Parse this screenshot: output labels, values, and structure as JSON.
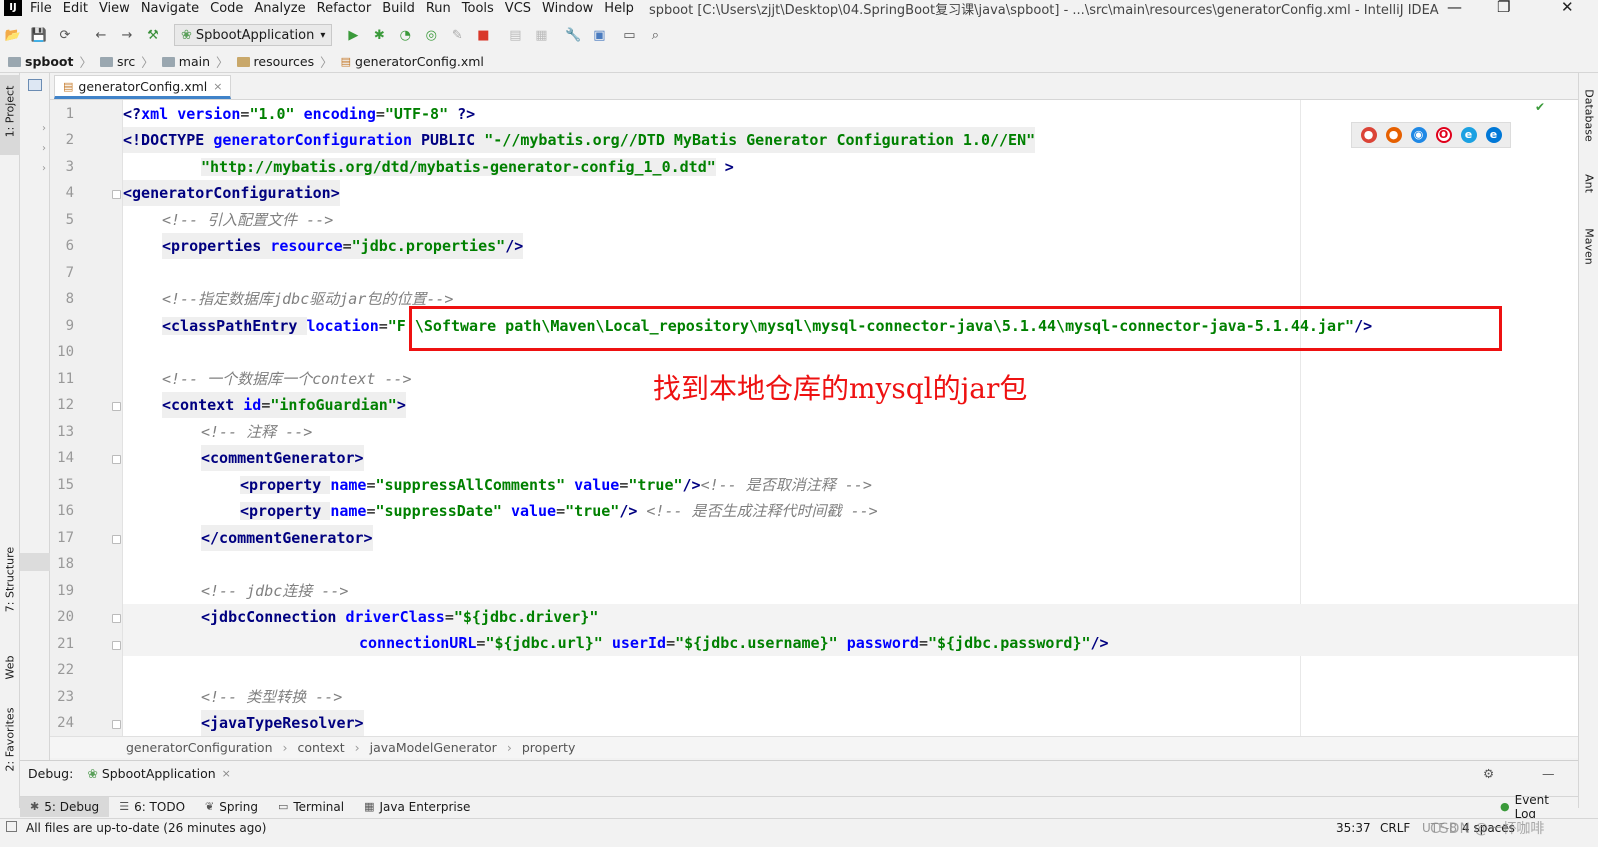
{
  "app": {
    "logo": "IJ",
    "title": "spboot [C:\\Users\\zjjt\\Desktop\\04.SpringBoot复习课\\java\\spboot] - ...\\src\\main\\resources\\generatorConfig.xml - IntelliJ IDEA",
    "window_controls": {
      "minimize": "—",
      "restore": "❐",
      "close": "✕"
    }
  },
  "menu": [
    "File",
    "Edit",
    "View",
    "Navigate",
    "Code",
    "Analyze",
    "Refactor",
    "Build",
    "Run",
    "Tools",
    "VCS",
    "Window",
    "Help"
  ],
  "toolbar": {
    "run_config": "SpbootApplication"
  },
  "navbar": {
    "crumbs": [
      "spboot",
      "src",
      "main",
      "resources",
      "generatorConfig.xml"
    ]
  },
  "left_tools": [
    "1: Project",
    "7: Structure",
    "Web",
    "2: Favorites"
  ],
  "right_tools": [
    "Database",
    "Ant",
    "Maven"
  ],
  "editor_tab": {
    "label": "generatorConfig.xml",
    "close": "×"
  },
  "line_numbers": [
    "1",
    "2",
    "3",
    "4",
    "5",
    "6",
    "7",
    "8",
    "9",
    "10",
    "11",
    "12",
    "13",
    "14",
    "15",
    "16",
    "17",
    "18",
    "19",
    "20",
    "21",
    "22",
    "23",
    "24"
  ],
  "code": {
    "l1": [
      "<?",
      "xml ",
      "version",
      "=",
      "\"1.0\"",
      " ",
      "encoding",
      "=",
      "\"UTF-8\"",
      " ",
      "?>"
    ],
    "l2": [
      "<!DOCTYPE ",
      "generatorConfiguration ",
      "PUBLIC ",
      "\"-//mybatis.org//DTD MyBatis Generator Configuration 1.0//EN\""
    ],
    "l3": [
      "\"http://mybatis.org/dtd/mybatis-generator-config_1_0.dtd\"",
      " >"
    ],
    "l4": [
      "<generatorConfiguration>"
    ],
    "l5": [
      "<!-- 引入配置文件 -->"
    ],
    "l6": [
      "<properties ",
      "resource",
      "=",
      "\"jdbc.properties\"",
      "/>"
    ],
    "l8": [
      "<!--指定数据库jdbc驱动jar包的位置-->"
    ],
    "l9": [
      "<classPathEntry ",
      "location",
      "=",
      "\"F:\\Software path\\Maven\\Local_repository\\mysql\\mysql-connector-java\\5.1.44\\mysql-connector-java-5.1.44.jar\"",
      "/>"
    ],
    "l11": [
      "<!-- 一个数据库一个context -->"
    ],
    "l12": [
      "<context ",
      "id",
      "=",
      "\"infoGuardian\"",
      ">"
    ],
    "l13": [
      "<!-- 注释 -->"
    ],
    "l14": [
      "<commentGenerator>"
    ],
    "l15": [
      "<property ",
      "name",
      "=",
      "\"suppressAllComments\"",
      " ",
      "value",
      "=",
      "\"true\"",
      "/>",
      "<!-- 是否取消注释 -->"
    ],
    "l16": [
      "<property ",
      "name",
      "=",
      "\"suppressDate\"",
      " ",
      "value",
      "=",
      "\"true\"",
      "/>",
      " ",
      "<!-- 是否生成注释代时间戳 -->"
    ],
    "l17": [
      "</commentGenerator>"
    ],
    "l19": [
      "<!-- jdbc连接 -->"
    ],
    "l20": [
      "<jdbcConnection ",
      "driverClass",
      "=",
      "\"${jdbc.driver}\""
    ],
    "l21": [
      "connectionURL",
      "=",
      "\"${jdbc.url}\"",
      " ",
      "userId",
      "=",
      "\"${jdbc.username}\"",
      " ",
      "password",
      "=",
      "\"${jdbc.password}\"",
      "/>"
    ],
    "l23": [
      "<!-- 类型转换 -->"
    ],
    "l24": [
      "<javaTypeResolver>"
    ]
  },
  "annotation": "找到本地仓库的mysql的jar包",
  "editor_breadcrumb": [
    "generatorConfiguration",
    "context",
    "javaModelGenerator",
    "property"
  ],
  "debug": {
    "label": "Debug:",
    "tab": "SpbootApplication",
    "close": "×"
  },
  "tool_tabs": [
    "5: Debug",
    "6: TODO",
    "Spring",
    "Terminal",
    "Java Enterprise"
  ],
  "event_log": "Event Log",
  "status": {
    "message": "All files are up-to-date (26 minutes ago)",
    "position": "35:37",
    "line_sep": "CRLF",
    "encoding": "UTF-8",
    "indent": "4 spaces"
  },
  "watermark": "CSDN @一杯咖啡",
  "colors": {
    "tag": "#000080",
    "attr": "#0000ff",
    "value": "#008000",
    "comment": "#808080",
    "annotation": "#ee1111"
  }
}
